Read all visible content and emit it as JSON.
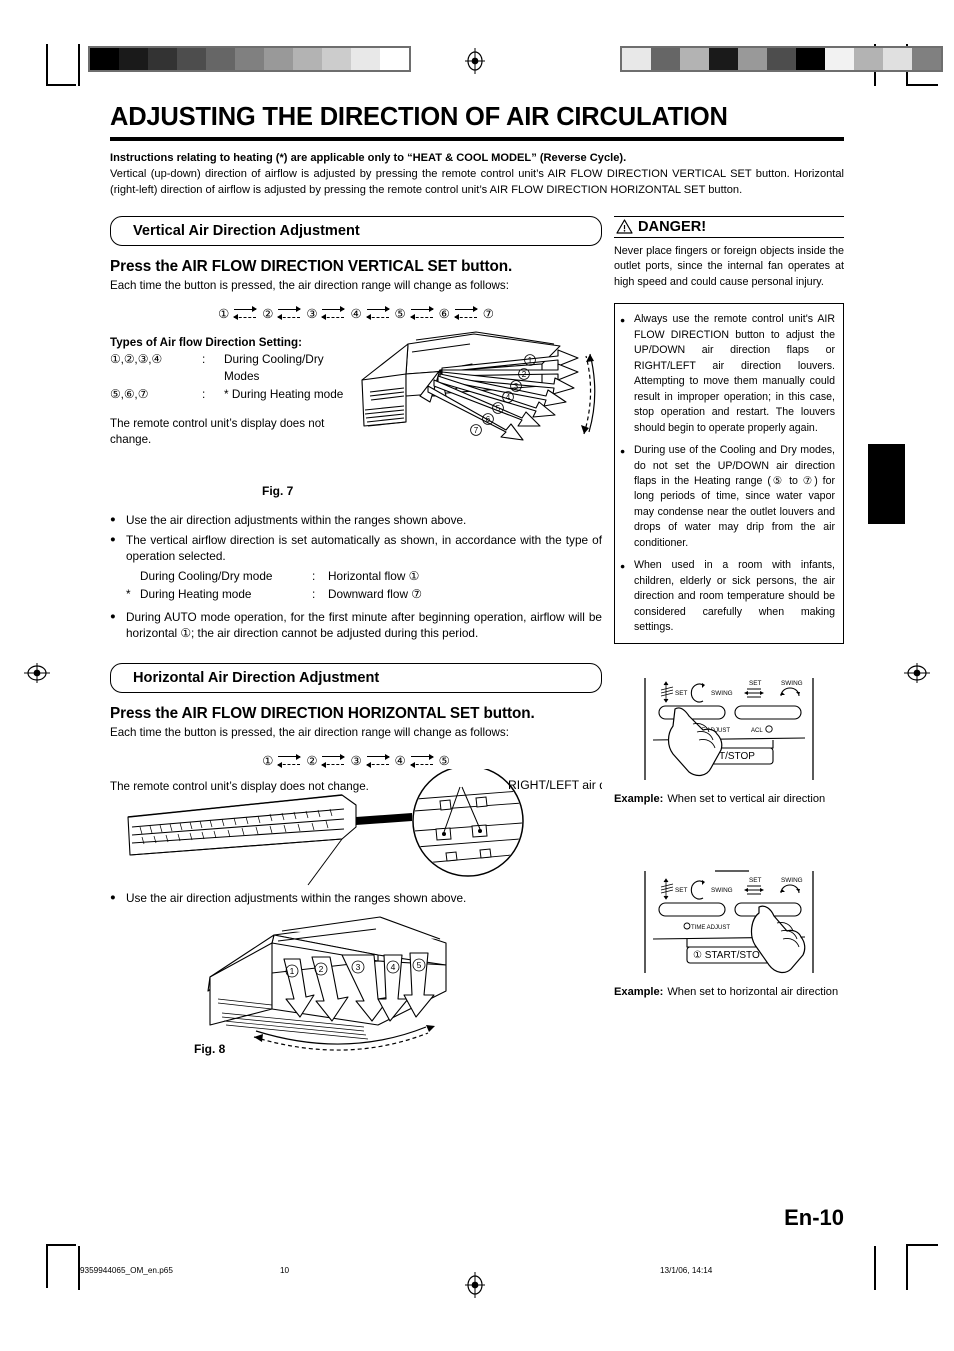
{
  "document": {
    "title": "ADJUSTING THE DIRECTION OF AIR CIRCULATION",
    "intro_bold": "Instructions relating to heating (*) are applicable only to “HEAT & COOL MODEL” (Reverse Cycle).",
    "intro_body": "Vertical (up-down) direction of airflow is adjusted by pressing the remote control unit’s AIR FLOW DIRECTION VERTICAL SET button. Horizontal (right-left) direction of airflow is adjusted by pressing the remote control unit’s AIR FLOW DIRECTION HORIZONTAL SET button."
  },
  "vertical_section": {
    "header": "Vertical Air Direction Adjustment",
    "lead": "Press the AIR FLOW DIRECTION VERTICAL SET button.",
    "sub": "Each time the button is pressed, the air direction range will change as follows:",
    "sequence": [
      "①",
      "②",
      "③",
      "④",
      "⑤",
      "⑥",
      "⑦"
    ],
    "types_title": "Types of Air flow Direction Setting:",
    "types_rows": [
      {
        "keys": "①,②,③,④",
        "colon": ":",
        "value": "During Cooling/Dry Modes"
      },
      {
        "keys": "⑤,⑥,⑦",
        "colon": ":",
        "value": "* During Heating mode"
      }
    ],
    "display_note": "The remote control unit’s display does not change.",
    "figure_caption": "Fig. 7",
    "figure_labels": [
      "①",
      "②",
      "③",
      "④",
      "⑤",
      "⑥",
      "⑦"
    ],
    "bullets": [
      "Use the air direction adjustments within the ranges shown above.",
      "The vertical airflow direction is set automatically as shown, in accordance with the type of operation selected.",
      "During AUTO mode operation, for the first minute after beginning operation, airflow will be horizontal ①; the air direction cannot be adjusted during this period."
    ],
    "mode_lines": [
      {
        "star": "",
        "mode": "During Cooling/Dry mode",
        "colon": ":",
        "flow": "Horizontal flow ①"
      },
      {
        "star": "*",
        "mode": "During Heating mode",
        "colon": ":",
        "flow": "Downward flow ⑦"
      }
    ]
  },
  "horizontal_section": {
    "header": "Horizontal Air Direction Adjustment",
    "lead": "Press the AIR FLOW DIRECTION HORIZONTAL SET button.",
    "sub": "Each time the button is pressed, the air direction range will change as follows:",
    "sequence": [
      "①",
      "②",
      "③",
      "④",
      "⑤"
    ],
    "display_note": "The remote control unit’s display does not change.",
    "louver_label": "RIGHT/LEFT air direction louvers",
    "bullets": [
      "Use the air direction adjustments within the ranges shown above."
    ],
    "figure_caption": "Fig. 8",
    "figure_labels": [
      "①",
      "②",
      "③",
      "④",
      "⑤"
    ]
  },
  "danger": {
    "icon": "warning-triangle-icon",
    "heading": "DANGER!",
    "body": "Never place fingers or foreign objects inside the outlet ports, since the internal fan operates at high speed and could cause personal injury."
  },
  "caution": {
    "items": [
      "Always use the remote control unit's AIR FLOW DIRECTION button to adjust the UP/DOWN air direction flaps or RIGHT/LEFT air direction louvers. Attempting to move them manually could result in improper operation; in this case, stop operation and restart. The louvers should begin to operate properly again.",
      "During use of the Cooling and Dry modes, do not set the UP/DOWN air direction flaps in the Heating range (⑤ to ⑦) for long periods of time, since water vapor may condense near the outlet louvers and drops of water may drip from the air conditioner.",
      "When used in a room with infants, children, elderly or sick persons, the air direction and room temperature should be considered carefully when making settings."
    ]
  },
  "examples": [
    {
      "label": "Example:",
      "text": "When set to vertical air direction",
      "remote": {
        "buttons": [
          {
            "icon": "set-vertical-icon",
            "label": "SET"
          },
          {
            "icon": "swing-vertical-icon",
            "label": "SWING"
          },
          {
            "icon": "set-horizontal-icon",
            "label": "SET"
          },
          {
            "icon": "swing-horizontal-icon",
            "label": "SWING"
          }
        ],
        "small_labels": [
          "TIME ADJUST",
          "ACL"
        ],
        "main_button": "T/STOP",
        "pressed": "left"
      }
    },
    {
      "label": "Example:",
      "text": "When set to horizontal air direction",
      "remote": {
        "buttons": [
          {
            "icon": "set-vertical-icon",
            "label": "SET"
          },
          {
            "icon": "swing-vertical-icon",
            "label": "SWING"
          },
          {
            "icon": "set-horizontal-icon",
            "label": "SET"
          },
          {
            "icon": "swing-horizontal-icon",
            "label": "SWING"
          }
        ],
        "small_labels": [
          "TIME ADJUST",
          "ACL"
        ],
        "main_button": "① START/STO",
        "pressed": "right"
      }
    }
  ],
  "footer": {
    "page_label": "En-10",
    "file_name": "9359944065_OM_en.p65",
    "page_number": "10",
    "date": "13/1/06, 14:14"
  },
  "print_marks": {
    "left_wedge": [
      "#000000",
      "#1a1a1a",
      "#333333",
      "#4d4d4d",
      "#666666",
      "#808080",
      "#999999",
      "#b3b3b3",
      "#cccccc",
      "#e8e8e8",
      "#ffffff"
    ],
    "right_wedge": [
      "#e8e8e8",
      "#666666",
      "#b3b3b3",
      "#1a1a1a",
      "#999999",
      "#4d4d4d",
      "#000000",
      "#f2f2f2",
      "#b3b3b3",
      "#e0e0e0",
      "#808080"
    ]
  }
}
